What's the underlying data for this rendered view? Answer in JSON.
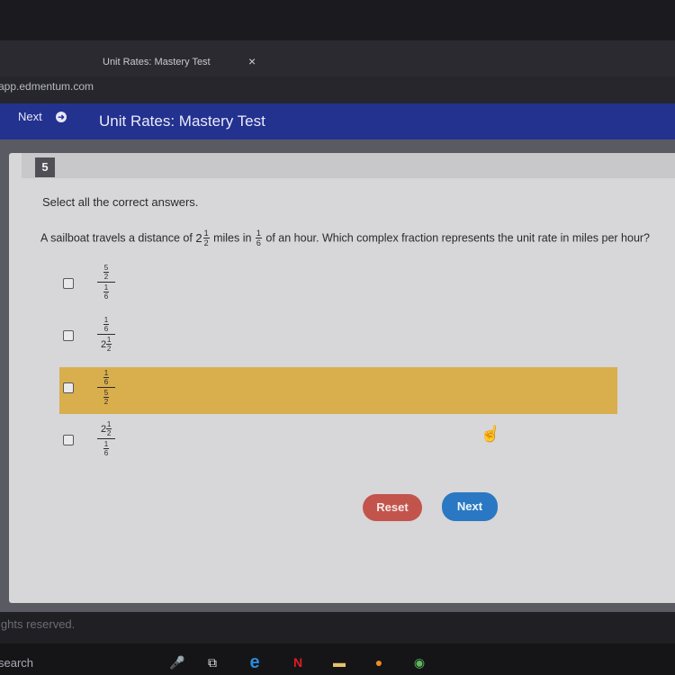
{
  "browser": {
    "tab_title": "Unit Rates: Mastery Test",
    "tab_close": "×",
    "address": "app.edmentum.com"
  },
  "header": {
    "next_label": "Next",
    "title": "Unit Rates: Mastery Test"
  },
  "question": {
    "number": "5",
    "instruction": "Select all the correct answers.",
    "prompt_part1": "A sailboat travels a distance of",
    "distance_whole": "2",
    "distance_num": "1",
    "distance_den": "2",
    "prompt_part2": "miles in",
    "time_num": "1",
    "time_den": "6",
    "prompt_part3": "of an hour. Which complex fraction represents the unit rate in miles per hour?"
  },
  "options": [
    {
      "top_num": "5",
      "top_den": "2",
      "bottom_num": "1",
      "bottom_den": "6",
      "selected": false,
      "highlighted": false
    },
    {
      "top_num": "1",
      "top_den": "6",
      "bottom_whole": "2",
      "bottom_num": "1",
      "bottom_den": "2",
      "selected": false,
      "highlighted": false
    },
    {
      "top_num": "1",
      "top_den": "6",
      "bottom_num": "5",
      "bottom_den": "2",
      "selected": false,
      "highlighted": true
    },
    {
      "top_whole": "2",
      "top_num": "1",
      "top_den": "2",
      "bottom_num": "1",
      "bottom_den": "6",
      "selected": false,
      "highlighted": false
    }
  ],
  "buttons": {
    "reset_label": "Reset",
    "next_label": "Next"
  },
  "footer": {
    "rights_text": "ights reserved."
  },
  "taskbar": {
    "search_label": "search",
    "icons": [
      "microphone-icon",
      "task-view-icon",
      "edge-browser-icon",
      "netflix-icon",
      "file-explorer-icon",
      "firefox-icon",
      "chrome-icon"
    ]
  },
  "colors": {
    "header_bg": "#23318f",
    "highlight": "#d9ae4c",
    "reset_btn": "#c2544c",
    "next_btn": "#2a78c3"
  }
}
